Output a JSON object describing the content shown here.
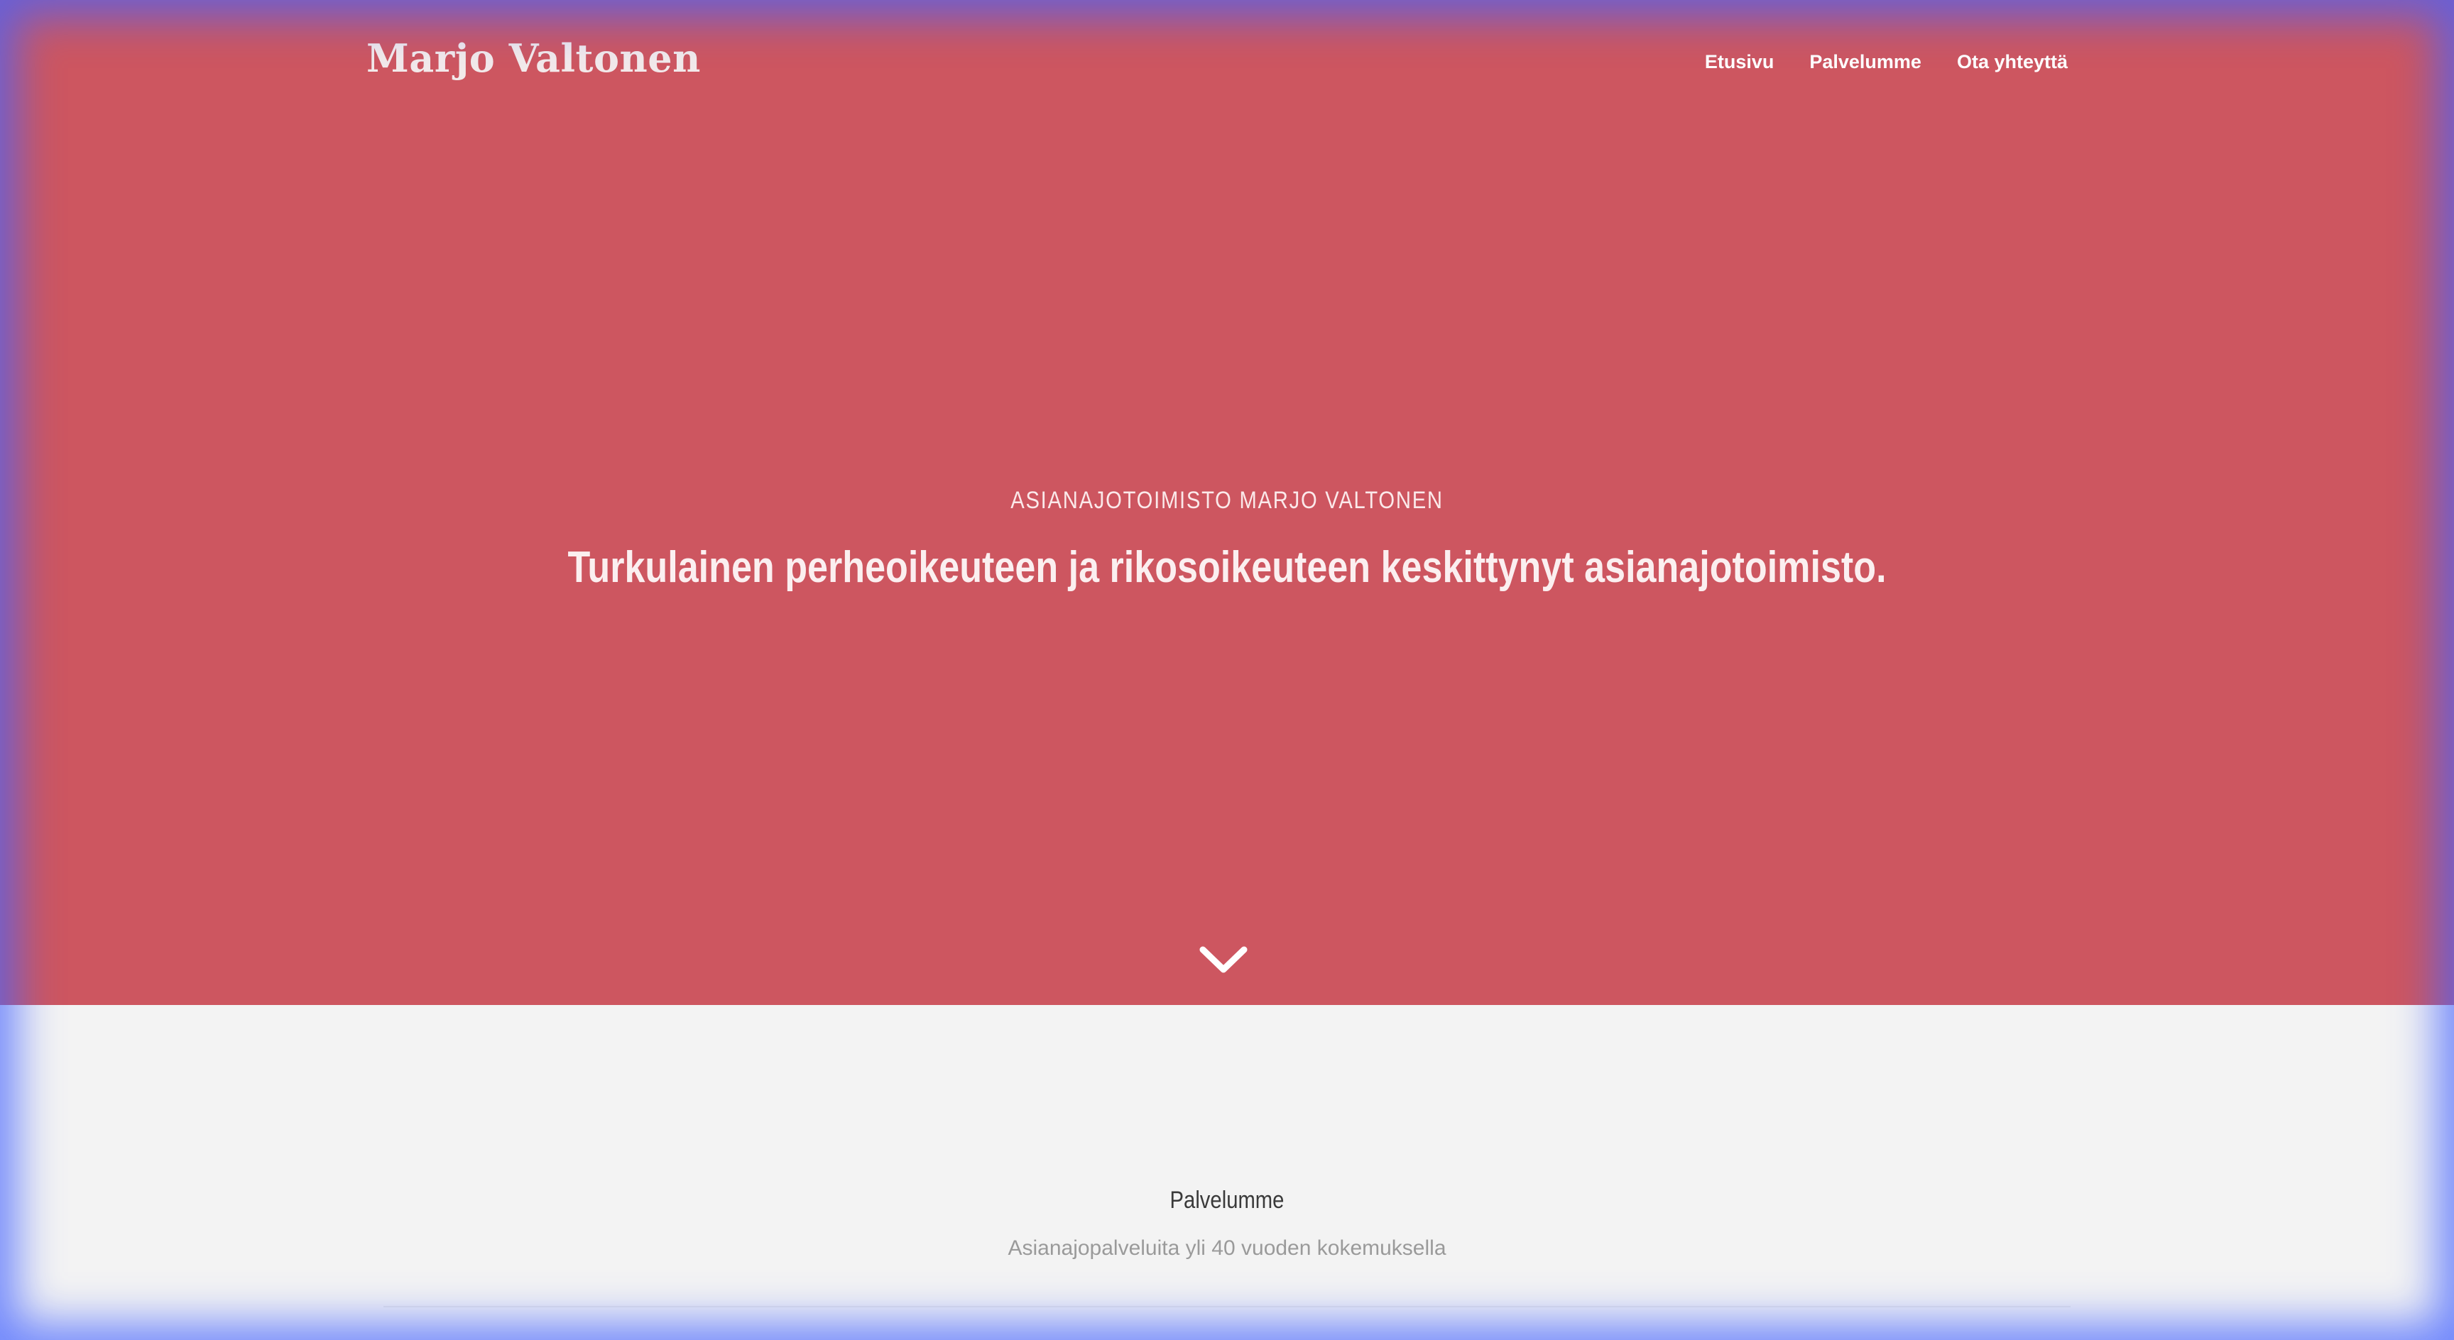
{
  "header": {
    "brand": "Marjo Valtonen",
    "nav": [
      {
        "label": "Etusivu"
      },
      {
        "label": "Palvelumme"
      },
      {
        "label": "Ota yhteyttä"
      }
    ]
  },
  "hero": {
    "eyebrow": "ASIANAJOTOIMISTO MARJO VALTONEN",
    "headline": "Turkulainen perheoikeuteen ja rikosoikeuteen keskittynyt asianajotoimisto.",
    "scroll_icon": "chevron-down-icon",
    "background_color": "#cd5660"
  },
  "services": {
    "title": "Palvelumme",
    "subtitle": "Asianajopalveluita yli 40 vuoden kokemuksella"
  }
}
